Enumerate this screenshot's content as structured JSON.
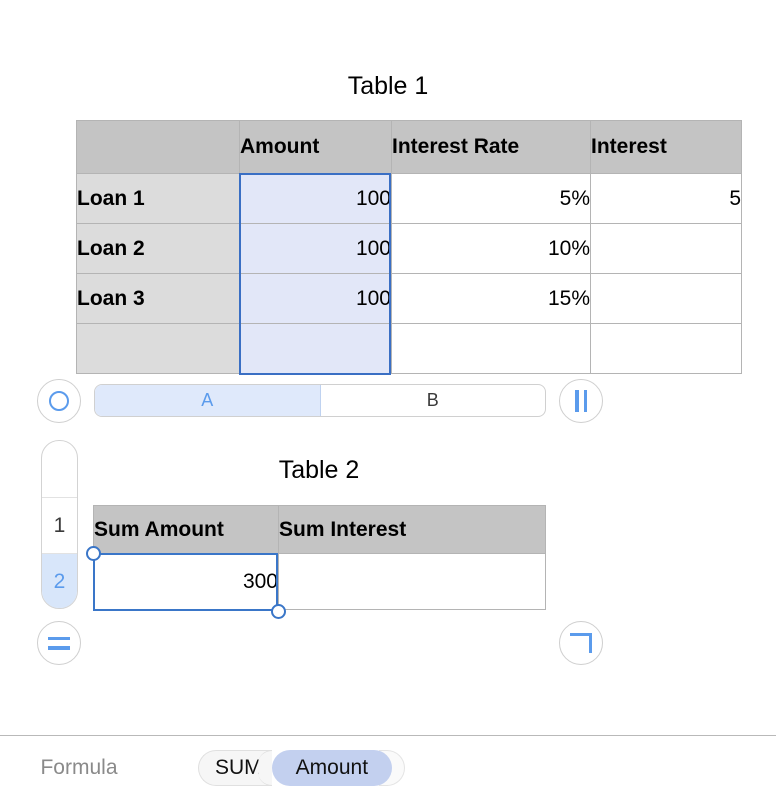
{
  "tables": [
    {
      "title": "Table 1",
      "columns": [
        "",
        "Amount",
        "Interest Rate",
        "Interest"
      ],
      "rows": [
        {
          "label": "Loan 1",
          "amount": "100",
          "rate": "5%",
          "interest": "5"
        },
        {
          "label": "Loan 2",
          "amount": "100",
          "rate": "10%",
          "interest": ""
        },
        {
          "label": "Loan 3",
          "amount": "100",
          "rate": "15%",
          "interest": ""
        },
        {
          "label": "",
          "amount": "",
          "rate": "",
          "interest": ""
        }
      ]
    },
    {
      "title": "Table 2",
      "columns": [
        "Sum Amount",
        "Sum Interest"
      ],
      "rows": [
        {
          "sum_amount": "300",
          "sum_interest": ""
        }
      ]
    }
  ],
  "segmented_control": {
    "options": [
      {
        "label": "A",
        "selected": true
      },
      {
        "label": "B",
        "selected": false
      }
    ]
  },
  "round_buttons": {
    "record": "record-icon",
    "pause": "pause-icon",
    "equals": "equals-icon",
    "corner": "corner-bracket-icon"
  },
  "row_gutter": {
    "cells": [
      {
        "label": "",
        "selected": false
      },
      {
        "label": "1",
        "selected": false
      },
      {
        "label": "2",
        "selected": true
      }
    ]
  },
  "formula_bar": {
    "label": "Formula",
    "tokens": [
      {
        "type": "function",
        "text": "SUM"
      },
      {
        "type": "paren-open",
        "text": "("
      },
      {
        "type": "argument",
        "text": "Amount"
      },
      {
        "type": "paren-close",
        "text": ")"
      }
    ]
  },
  "colors": {
    "accent_blue": "#5b9bec",
    "selection_border": "#3a76c8",
    "header_gray": "#c4c4c4",
    "rowlabel_gray": "#dcdcdc",
    "selected_cell_blue": "#e2e7f8",
    "token_blue": "#c3d0ef"
  }
}
